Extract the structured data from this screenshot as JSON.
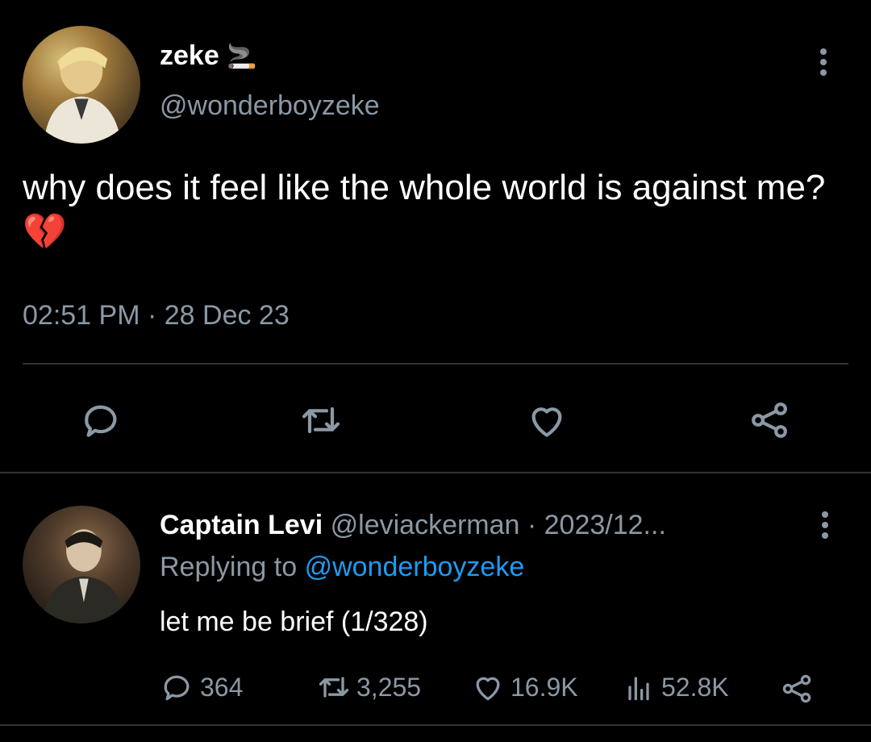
{
  "tweet": {
    "author_name": "zeke",
    "author_emoji": "🚬",
    "author_handle": "@wonderboyzeke",
    "text": "why does it feel like the whole world is against me?",
    "text_emoji": "💔",
    "timestamp": "02:51 PM · 28 Dec 23"
  },
  "reply": {
    "author_name": "Captain Levi",
    "author_meta": "@leviackerman · 2023/12...",
    "replying_prefix": "Replying to",
    "replying_handle": "@wonderboyzeke",
    "text": "let me be brief (1/328)",
    "stats": {
      "replies": "364",
      "retweets": "3,255",
      "likes": "16.9K",
      "views": "52.8K"
    }
  },
  "colors": {
    "background": "#000000",
    "text_primary": "#ffffff",
    "text_secondary": "#8b98a5",
    "link": "#1d9bf0",
    "divider": "#2f3336"
  },
  "icons": [
    "more-vertical-icon",
    "comment-icon",
    "retweet-icon",
    "heart-icon",
    "share-icon",
    "views-icon",
    "cigarette-emoji",
    "broken-heart-emoji"
  ]
}
